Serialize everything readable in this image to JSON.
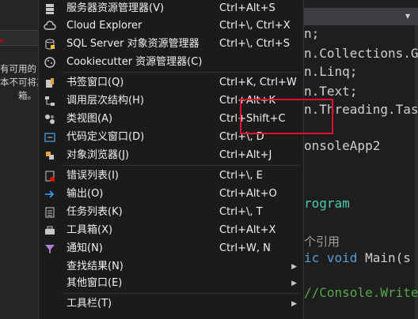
{
  "left_panel": {
    "lines": [
      "有可用的",
      "本不可将其",
      "箱。"
    ]
  },
  "editor": {
    "lines": [
      {
        "parts": [
          {
            "t": "n;",
            "c": "pl"
          }
        ]
      },
      {
        "parts": [
          {
            "t": "n.Collections.G",
            "c": "pl"
          }
        ]
      },
      {
        "parts": [
          {
            "t": "n.Linq;",
            "c": "pl"
          }
        ]
      },
      {
        "parts": [
          {
            "t": "n.Text;",
            "c": "pl"
          }
        ]
      },
      {
        "parts": [
          {
            "t": "n.Threading.Tas",
            "c": "pl"
          }
        ]
      },
      {
        "parts": [
          {
            "t": "onsoleApp2",
            "c": "pl"
          }
        ]
      },
      {
        "parts": [
          {
            "t": "rogram",
            "c": "ty"
          }
        ]
      },
      {
        "parts": [
          {
            "t": "个引用",
            "c": "ref"
          }
        ]
      },
      {
        "parts": [
          {
            "t": "ic void ",
            "c": "kw"
          },
          {
            "t": "Main(s",
            "c": "pl"
          }
        ]
      },
      {
        "parts": [
          {
            "t": "//Console.Write",
            "c": "cm"
          }
        ]
      }
    ]
  },
  "menu": {
    "items": [
      {
        "label": "服务器资源管理器(V)",
        "shortcut": "Ctrl+Alt+S",
        "icon": "server-explorer-icon",
        "submenu": false
      },
      {
        "label": "Cloud Explorer",
        "shortcut": "Ctrl+\\, Ctrl+X",
        "icon": "cloud-icon",
        "submenu": false
      },
      {
        "label": "SQL Server 对象资源管理器",
        "shortcut": "Ctrl+\\, Ctrl+S",
        "icon": "database-icon",
        "submenu": false
      },
      {
        "label": "Cookiecutter 资源管理器(C)",
        "shortcut": "",
        "icon": "cookie-icon",
        "submenu": false
      },
      {
        "label": "书签窗口(Q)",
        "shortcut": "Ctrl+K, Ctrl+W",
        "icon": "bookmark-icon",
        "submenu": false
      },
      {
        "label": "调用层次结构(H)",
        "shortcut": "Ctrl+Alt+K",
        "icon": "call-hierarchy-icon",
        "submenu": false
      },
      {
        "label": "类视图(A)",
        "shortcut": "Ctrl+Shift+C",
        "icon": "class-view-icon",
        "submenu": false
      },
      {
        "label": "代码定义窗口(D)",
        "shortcut": "Ctrl+\\, D",
        "icon": "code-definition-icon",
        "submenu": false
      },
      {
        "label": "对象浏览器(J)",
        "shortcut": "Ctrl+Alt+J",
        "icon": "object-browser-icon",
        "submenu": false
      },
      {
        "label": "错误列表(I)",
        "shortcut": "Ctrl+\\, E",
        "icon": "error-list-icon",
        "submenu": false
      },
      {
        "label": "输出(O)",
        "shortcut": "Ctrl+Alt+O",
        "icon": "output-icon",
        "submenu": false
      },
      {
        "label": "任务列表(K)",
        "shortcut": "Ctrl+\\, T",
        "icon": "task-list-icon",
        "submenu": false
      },
      {
        "label": "工具箱(X)",
        "shortcut": "Ctrl+Alt+X",
        "icon": "toolbox-icon",
        "submenu": false
      },
      {
        "label": "通知(N)",
        "shortcut": "Ctrl+W, N",
        "icon": "notification-icon",
        "submenu": false
      },
      {
        "label": "查找结果(N)",
        "shortcut": "",
        "icon": "",
        "submenu": true
      },
      {
        "label": "其他窗口(E)",
        "shortcut": "",
        "icon": "",
        "submenu": true
      },
      {
        "label": "工具栏(T)",
        "shortcut": "",
        "icon": "",
        "submenu": true
      }
    ]
  },
  "colors": {
    "menu_bg": "#1b1b1c",
    "highlight_box": "#e0102f",
    "keyword": "#569cd6",
    "type": "#4ec9b0",
    "comment": "#57a64a"
  }
}
